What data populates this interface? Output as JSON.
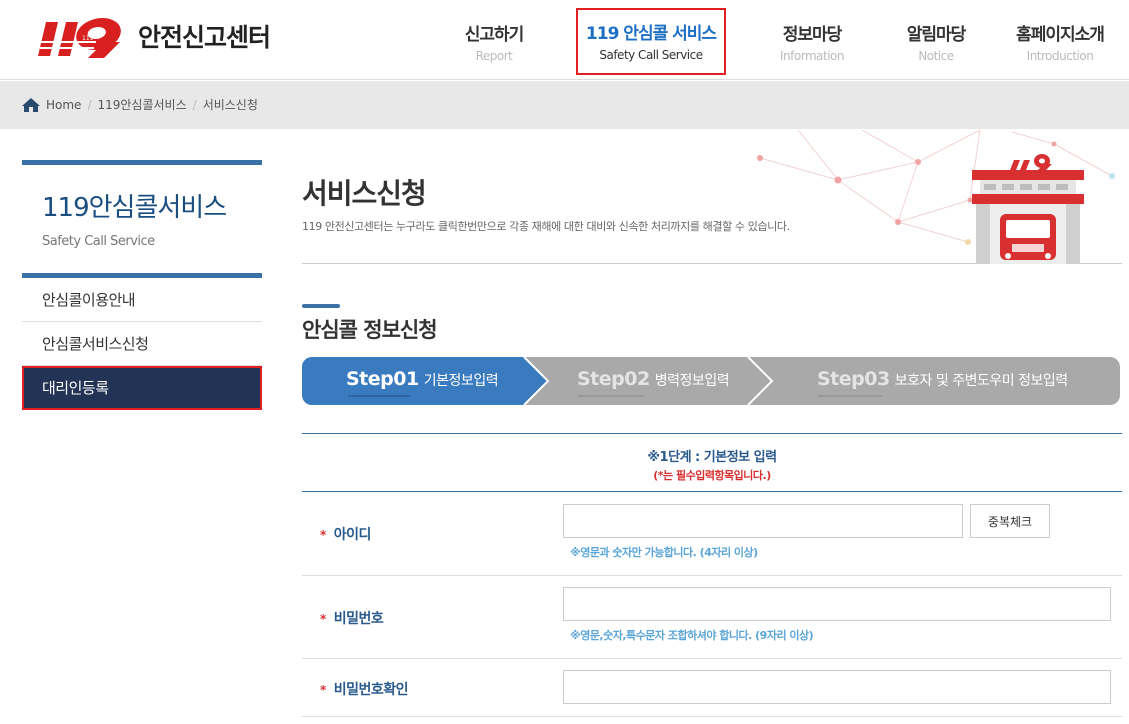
{
  "header": {
    "logo_number": "119",
    "logo_text": "안전신고센터",
    "nav": [
      {
        "kr": "신고하기",
        "en": "Report"
      },
      {
        "kr": "119 안심콜 서비스",
        "en": "Safety Call Service"
      },
      {
        "kr": "정보마당",
        "en": "Information"
      },
      {
        "kr": "알림마당",
        "en": "Notice"
      },
      {
        "kr": "홈페이지소개",
        "en": "Introduction"
      }
    ]
  },
  "breadcrumb": [
    "Home",
    "119안심콜서비스",
    "서비스신청"
  ],
  "sidebar": {
    "title": "119안심콜서비스",
    "subtitle": "Safety Call Service",
    "items": [
      "안심콜이용안내",
      "안심콜서비스신청",
      "대리인등록"
    ]
  },
  "page": {
    "title": "서비스신청",
    "description": "119 안전신고센터는 누구라도 클릭한번만으로 각종 재해에 대한 대비와 신속한 처리까지를 해결할 수 있습니다.",
    "section_title": "안심콜 정보신청"
  },
  "steps": [
    {
      "no": "Step01",
      "label": "기본정보입력"
    },
    {
      "no": "Step02",
      "label": "병력정보입력"
    },
    {
      "no": "Step03",
      "label": "보호자 및 주변도우미 정보입력"
    }
  ],
  "form": {
    "caption": "※1단계 : 기본정보 입력",
    "required_note": "(*는 필수입력항목입니다.)",
    "required_mark": "*",
    "fields": [
      {
        "label": "아이디",
        "value": "",
        "hint": "※영문과 숫자만 가능합니다. (4자리 이상)"
      },
      {
        "label": "비밀번호",
        "value": "",
        "hint": "※영문,숫자,특수문자 조합하셔야 합니다. (9자리 이상)"
      },
      {
        "label": "비밀번호확인",
        "value": "",
        "hint": ""
      }
    ],
    "dup_button": "중복체크"
  },
  "colors": {
    "accent": "#3a72a8",
    "nav_active": "#1d6fc4",
    "sidebar_active": "#223355",
    "step_active": "#3a7bbf",
    "step_inactive": "#a9a9a9",
    "required": "#d83030",
    "logo_red": "#d82020"
  }
}
